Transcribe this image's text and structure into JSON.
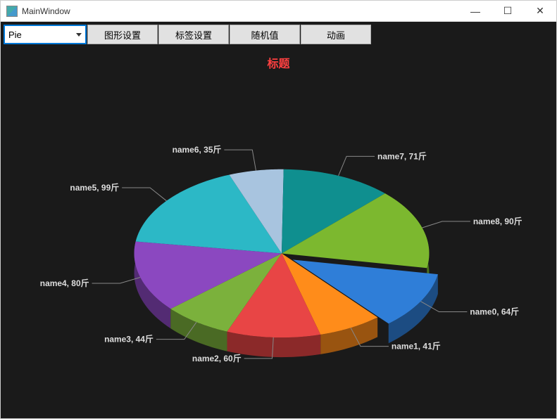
{
  "window": {
    "title": "MainWindow",
    "min": "—",
    "max": "☐",
    "close": "✕"
  },
  "toolbar": {
    "chart_type": "Pie",
    "btn_graph_settings": "图形设置",
    "btn_label_settings": "标签设置",
    "btn_random_value": "随机值",
    "btn_animation": "动画"
  },
  "chart_data": {
    "type": "pie",
    "title": "标题",
    "unit": "斤",
    "exploded_index": 0,
    "series": [
      {
        "name": "name0",
        "value": 64,
        "color": "#2f7ed8"
      },
      {
        "name": "name1",
        "value": 41,
        "color": "#ff8c1a"
      },
      {
        "name": "name2",
        "value": 60,
        "color": "#e84545"
      },
      {
        "name": "name3",
        "value": 44,
        "color": "#7bb13c"
      },
      {
        "name": "name4",
        "value": 80,
        "color": "#8b48c0"
      },
      {
        "name": "name5",
        "value": 99,
        "color": "#2cb8c6"
      },
      {
        "name": "name6",
        "value": 35,
        "color": "#a8c4df"
      },
      {
        "name": "name7",
        "value": 71,
        "color": "#0f8f8f"
      },
      {
        "name": "name8",
        "value": 90,
        "color": "#7cb82f"
      }
    ]
  }
}
